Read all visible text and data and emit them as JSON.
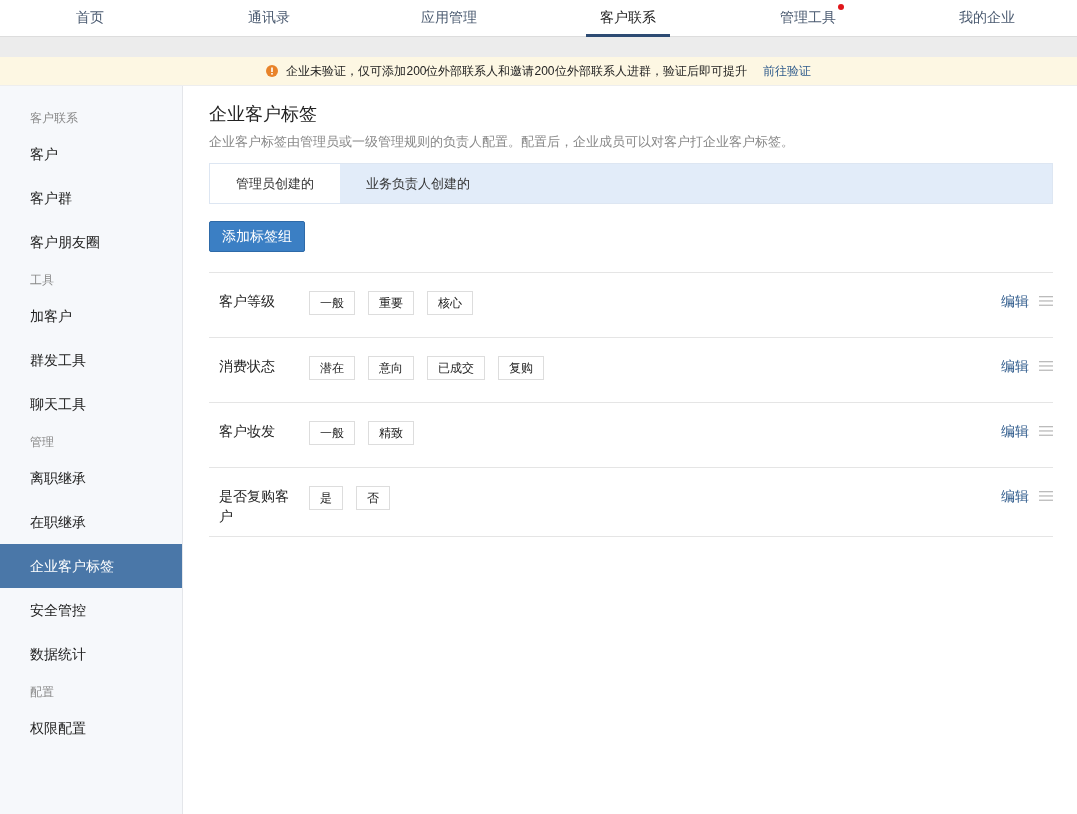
{
  "top_nav": [
    {
      "label": "首页",
      "selected": false,
      "dot": false
    },
    {
      "label": "通讯录",
      "selected": false,
      "dot": false
    },
    {
      "label": "应用管理",
      "selected": false,
      "dot": false
    },
    {
      "label": "客户联系",
      "selected": true,
      "dot": false
    },
    {
      "label": "管理工具",
      "selected": false,
      "dot": true
    },
    {
      "label": "我的企业",
      "selected": false,
      "dot": false
    }
  ],
  "notice": {
    "text": "企业未验证，仅可添加200位外部联系人和邀请200位外部联系人进群，验证后即可提升",
    "link": "前往验证"
  },
  "sidebar": {
    "sections": [
      {
        "header": "客户联系",
        "items": [
          {
            "label": "客户",
            "selected": false
          },
          {
            "label": "客户群",
            "selected": false
          },
          {
            "label": "客户朋友圈",
            "selected": false
          }
        ]
      },
      {
        "header": "工具",
        "items": [
          {
            "label": "加客户",
            "selected": false
          },
          {
            "label": "群发工具",
            "selected": false
          },
          {
            "label": "聊天工具",
            "selected": false
          }
        ]
      },
      {
        "header": "管理",
        "items": [
          {
            "label": "离职继承",
            "selected": false
          },
          {
            "label": "在职继承",
            "selected": false
          },
          {
            "label": "企业客户标签",
            "selected": true
          },
          {
            "label": "安全管控",
            "selected": false
          },
          {
            "label": "数据统计",
            "selected": false
          }
        ]
      },
      {
        "header": "配置",
        "items": [
          {
            "label": "权限配置",
            "selected": false
          }
        ]
      }
    ]
  },
  "page": {
    "title": "企业客户标签",
    "description": "企业客户标签由管理员或一级管理规则的负责人配置。配置后，企业成员可以对客户打企业客户标签。",
    "tabs": [
      {
        "label": "管理员创建的",
        "selected": true
      },
      {
        "label": "业务负责人创建的",
        "selected": false
      }
    ],
    "add_button": "添加标签组",
    "tag_groups": [
      {
        "name": "客户等级",
        "tags": [
          "一般",
          "重要",
          "核心"
        ],
        "edit": "编辑"
      },
      {
        "name": "消费状态",
        "tags": [
          "潜在",
          "意向",
          "已成交",
          "复购"
        ],
        "edit": "编辑"
      },
      {
        "name": "客户妆发",
        "tags": [
          "一般",
          "精致"
        ],
        "edit": "编辑"
      },
      {
        "name": "是否复购客户",
        "tags": [
          "是",
          "否"
        ],
        "edit": "编辑"
      }
    ]
  }
}
